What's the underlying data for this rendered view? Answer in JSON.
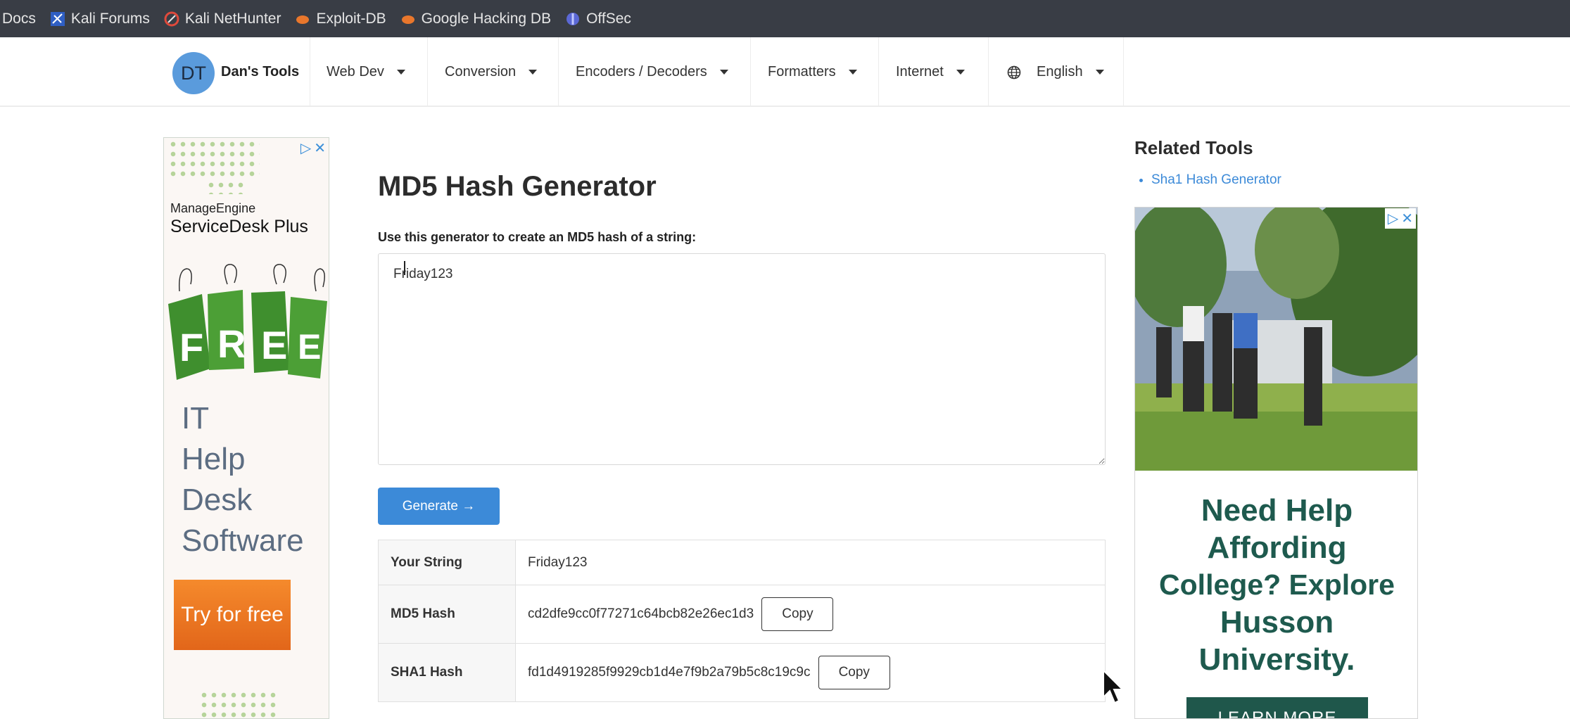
{
  "bookmarks": [
    {
      "label": "Docs",
      "icon": "docs-icon"
    },
    {
      "label": "Kali Forums",
      "icon": "kali-icon"
    },
    {
      "label": "Kali NetHunter",
      "icon": "nethunter-icon"
    },
    {
      "label": "Exploit-DB",
      "icon": "exploitdb-icon"
    },
    {
      "label": "Google Hacking DB",
      "icon": "ghdb-icon"
    },
    {
      "label": "OffSec",
      "icon": "offsec-icon"
    }
  ],
  "header": {
    "logo_initials": "DT",
    "brand": "Dan's Tools",
    "nav": [
      {
        "label": "Web Dev"
      },
      {
        "label": "Conversion"
      },
      {
        "label": "Encoders / Decoders"
      },
      {
        "label": "Formatters"
      },
      {
        "label": "Internet"
      },
      {
        "label": "English",
        "icon": "globe-icon"
      }
    ]
  },
  "main": {
    "title": "MD5 Hash Generator",
    "description": "Use this generator to create an MD5 hash of a string:",
    "input_value": "Friday123",
    "generate_label": "Generate →",
    "results": {
      "your_string_label": "Your String",
      "your_string_value": "Friday123",
      "md5_label": "MD5 Hash",
      "md5_value": "cd2dfe9cc0f77271c64bcb82e26ec1d3",
      "sha1_label": "SHA1 Hash",
      "sha1_value": "fd1d4919285f9929cb1d4e7f9b2a79b5c8c19c9c",
      "copy_label": "Copy"
    }
  },
  "sidebar": {
    "related_title": "Related Tools",
    "related_items": [
      "Sha1 Hash Generator"
    ]
  },
  "ad_left": {
    "brand": "ManageEngine",
    "product": "ServiceDesk Plus",
    "free_letters": [
      "F",
      "R",
      "E",
      "E"
    ],
    "headline_lines": [
      "IT",
      "Help",
      "Desk",
      "Software"
    ],
    "cta": "Try for free"
  },
  "ad_right": {
    "headline_lines": [
      "Need Help",
      "Affording",
      "College? Explore",
      "Husson",
      "University."
    ],
    "cta": "LEARN MORE"
  },
  "colors": {
    "accent": "#3c8ad8",
    "bookmarks_bg": "#393d45",
    "husson_green": "#1e5a4e",
    "cta_orange": "#f07d26"
  }
}
